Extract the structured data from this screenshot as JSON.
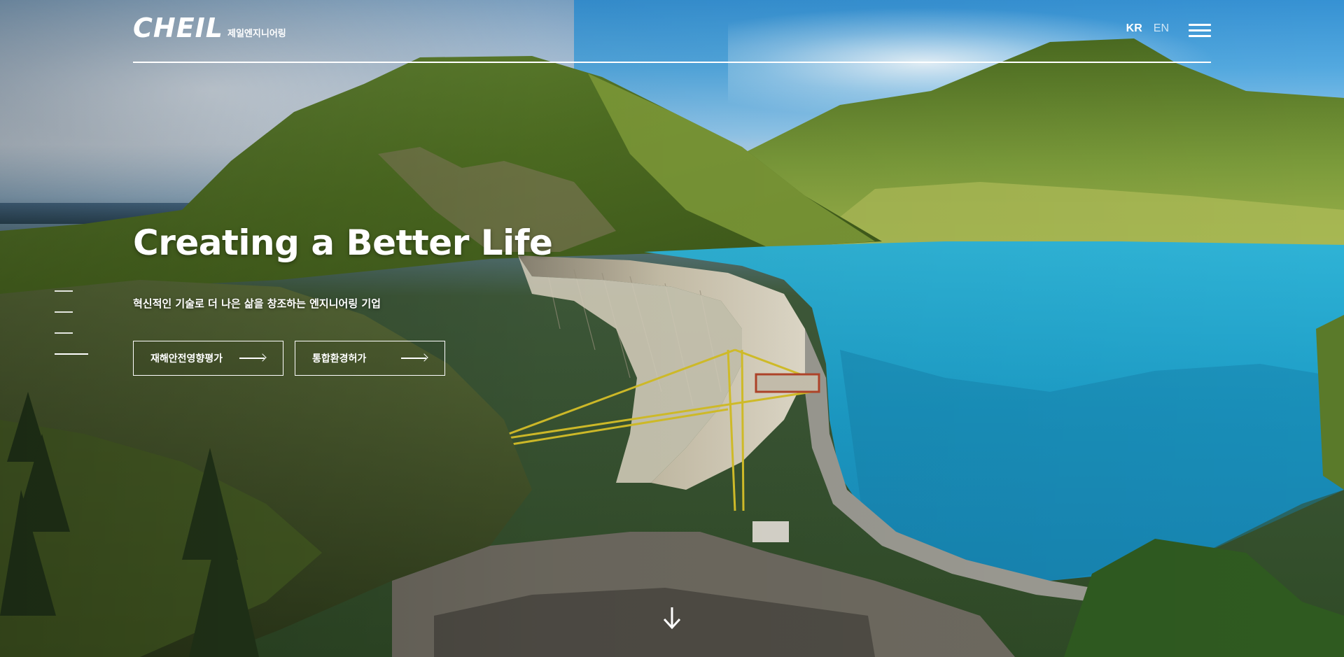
{
  "header": {
    "logo_text": "CHEIL",
    "logo_sub": "제일엔지니어링",
    "lang_kr": "KR",
    "lang_en": "EN"
  },
  "hero": {
    "title": "Creating a Better Life",
    "subtitle": "혁신적인 기술로 더 나은 삶을 창조하는 엔지니어링 기업",
    "buttons": [
      {
        "label": "재해안전영향평가"
      },
      {
        "label": "통합환경허가"
      }
    ]
  },
  "pager": {
    "count": 4,
    "active_index": 3
  },
  "icons": {
    "menu": "hamburger-menu-icon",
    "arrow": "arrow-right-icon",
    "scroll": "arrow-down-icon"
  },
  "colors": {
    "text": "#ffffff",
    "water": "#1f9fc4",
    "mountain": "#5a7a2a"
  }
}
